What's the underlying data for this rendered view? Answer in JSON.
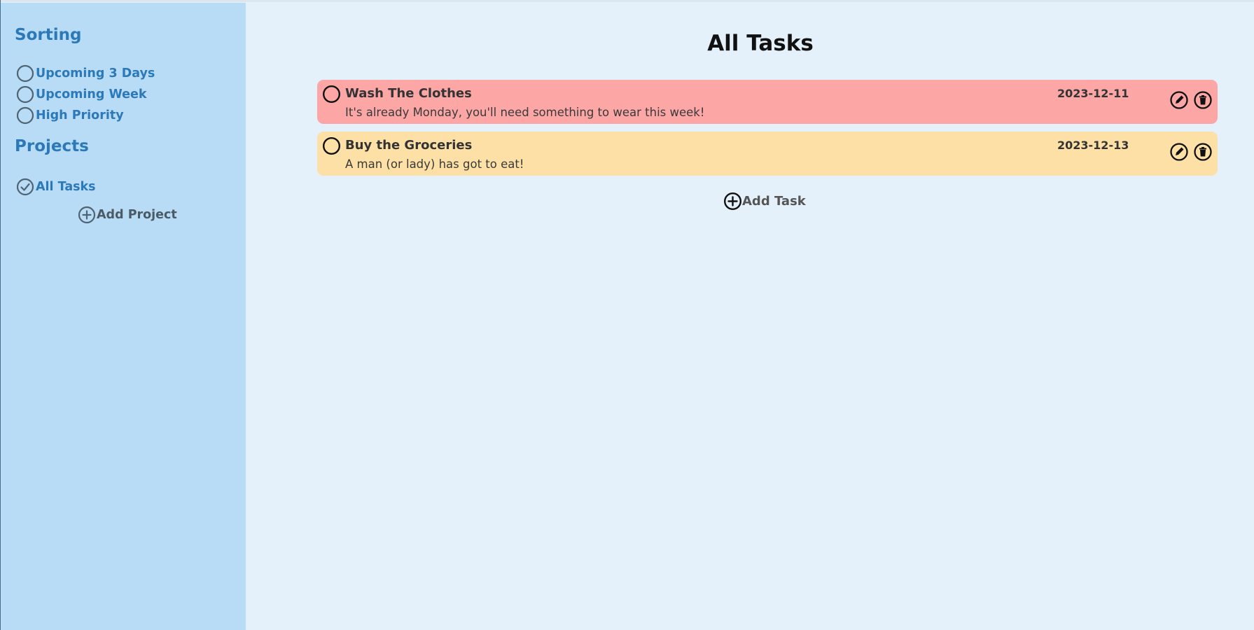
{
  "sidebar": {
    "sorting_heading": "Sorting",
    "sorting_items": [
      {
        "label": "Upcoming 3 Days"
      },
      {
        "label": "Upcoming Week"
      },
      {
        "label": "High Priority"
      }
    ],
    "projects_heading": "Projects",
    "project_items": [
      {
        "label": "All Tasks",
        "selected": true
      }
    ],
    "add_project_label": "Add Project"
  },
  "main": {
    "title": "All Tasks",
    "tasks": [
      {
        "title": "Wash The Clothes",
        "description": "It's already Monday, you'll need something to wear this week!",
        "date": "2023-12-11",
        "color": "#fca6a6"
      },
      {
        "title": "Buy the Groceries",
        "description": "A man (or lady) has got to eat!",
        "date": "2023-12-13",
        "color": "#fce0a6"
      }
    ],
    "add_task_label": "Add Task"
  },
  "colors": {
    "sidebar_bg": "#b9dcf6",
    "main_bg": "#e4f1fb",
    "accent": "#2b79b8"
  },
  "icons": {
    "radio": "empty-circle-icon",
    "check": "check-circle-icon",
    "add": "plus-circle-icon",
    "edit": "pencil-circle-icon",
    "delete": "trash-circle-icon"
  }
}
